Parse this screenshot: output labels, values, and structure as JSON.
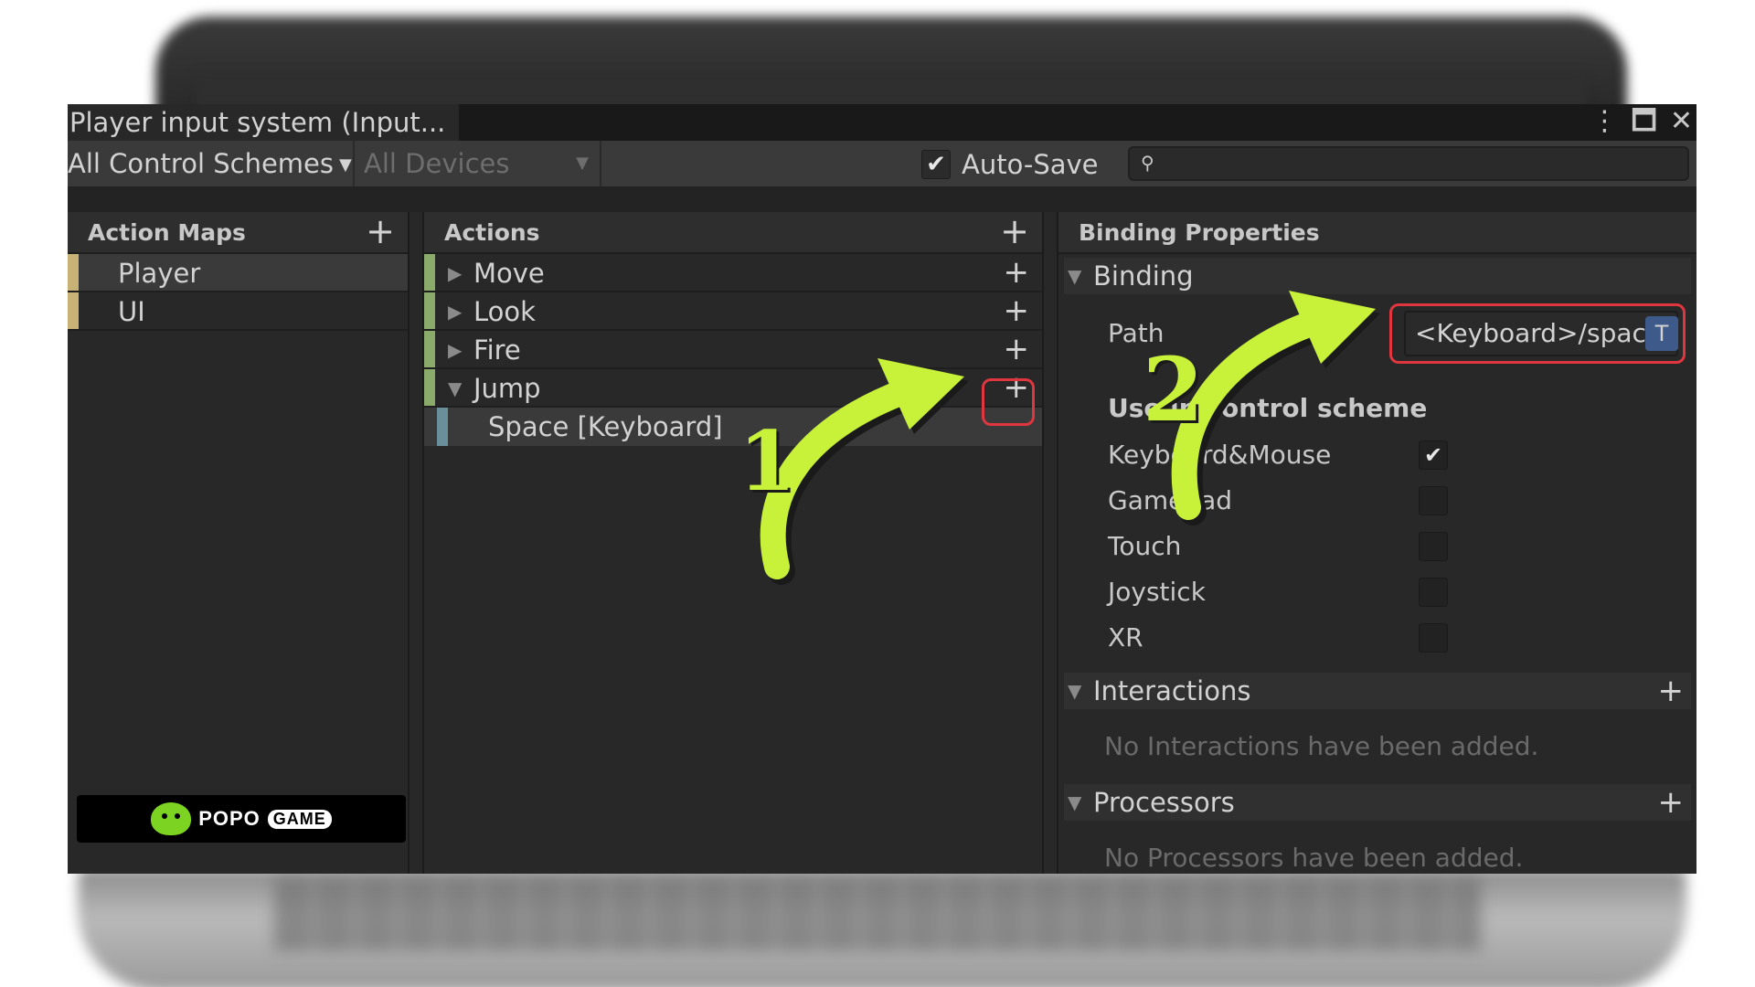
{
  "window": {
    "tab_title": "Player input system (Input...",
    "control_scheme_dropdown": "All Control Schemes",
    "devices_dropdown": "All Devices",
    "auto_save_label": "Auto-Save",
    "auto_save_checked": true,
    "search_placeholder": ""
  },
  "action_maps": {
    "header": "Action Maps",
    "items": [
      {
        "label": "Player",
        "selected": true
      },
      {
        "label": "UI",
        "selected": false
      }
    ]
  },
  "actions": {
    "header": "Actions",
    "items": [
      {
        "label": "Move",
        "expanded": false
      },
      {
        "label": "Look",
        "expanded": false
      },
      {
        "label": "Fire",
        "expanded": false
      },
      {
        "label": "Jump",
        "expanded": true
      }
    ],
    "binding": "Space [Keyboard]"
  },
  "binding_properties": {
    "header": "Binding Properties",
    "binding_section": "Binding",
    "path_label": "Path",
    "path_value": "<Keyboard>/spac",
    "t_button": "T",
    "use_scheme_title": "Use in control scheme",
    "schemes": [
      {
        "label": "Keyboard&Mouse",
        "checked": true
      },
      {
        "label": "Gamepad",
        "checked": false
      },
      {
        "label": "Touch",
        "checked": false
      },
      {
        "label": "Joystick",
        "checked": false
      },
      {
        "label": "XR",
        "checked": false
      }
    ],
    "interactions_section": "Interactions",
    "interactions_empty": "No Interactions have been added.",
    "processors_section": "Processors",
    "processors_empty": "No Processors have been added."
  },
  "annotations": {
    "step1": "1",
    "step2": "2",
    "arrow_color": "#c8f23a",
    "highlight_color": "#e0363f"
  },
  "logo": {
    "brand": "POPO",
    "brand_suffix": "GAME"
  }
}
